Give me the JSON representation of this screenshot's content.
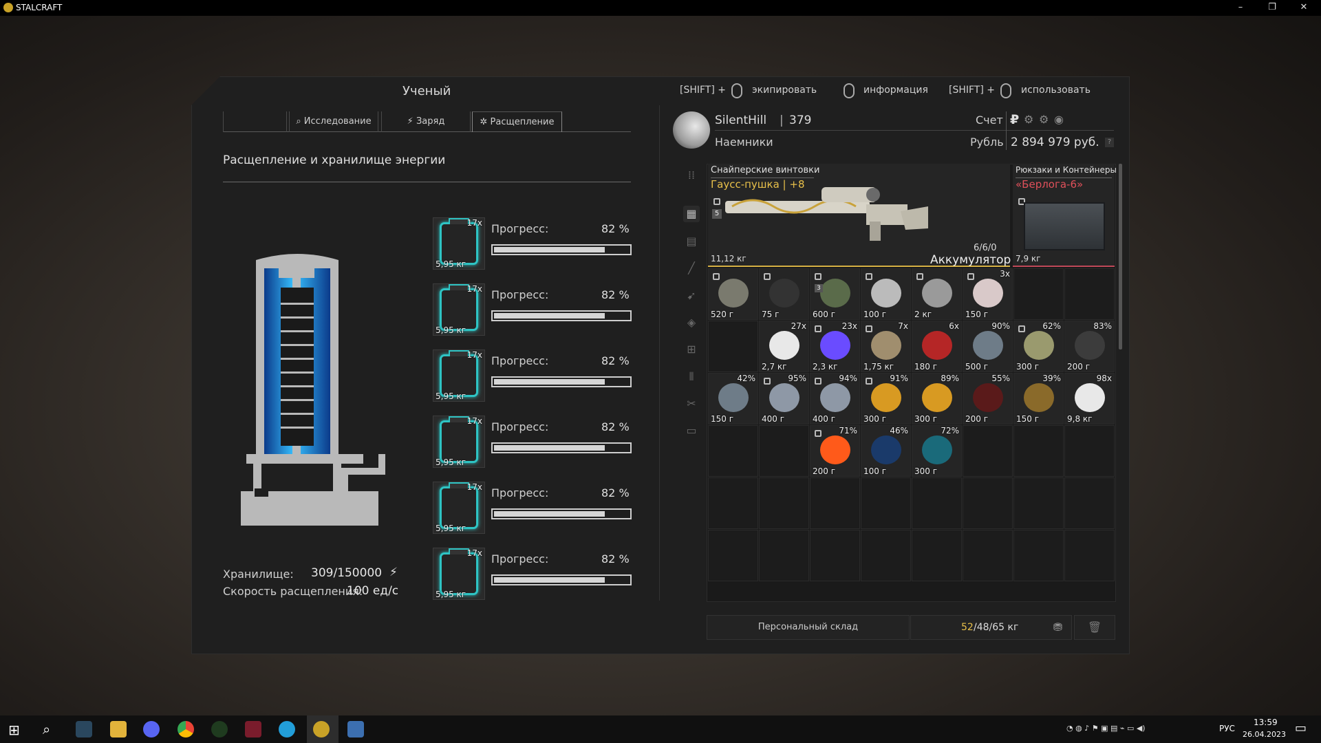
{
  "window": {
    "title": "STALCRAFT"
  },
  "left": {
    "npc_title": "Ученый",
    "tabs": [
      {
        "label": ""
      },
      {
        "label": "Исследование",
        "icon": "magnifier-icon"
      },
      {
        "label": "Заряд",
        "icon": "bolt-icon"
      },
      {
        "label": "Расщепление",
        "icon": "atom-icon"
      }
    ],
    "section_title": "Расщепление и хранилище энергии",
    "slots": [
      {
        "count": "17x",
        "weight": "5,95 кг",
        "progress_label": "Прогресс:",
        "progress": "82 %",
        "fraction": 0.82
      },
      {
        "count": "17x",
        "weight": "5,95 кг",
        "progress_label": "Прогресс:",
        "progress": "82 %",
        "fraction": 0.82
      },
      {
        "count": "17x",
        "weight": "5,95 кг",
        "progress_label": "Прогресс:",
        "progress": "82 %",
        "fraction": 0.82
      },
      {
        "count": "17x",
        "weight": "5,95 кг",
        "progress_label": "Прогресс:",
        "progress": "82 %",
        "fraction": 0.82
      },
      {
        "count": "17x",
        "weight": "5,95 кг",
        "progress_label": "Прогресс:",
        "progress": "82 %",
        "fraction": 0.82
      },
      {
        "count": "17x",
        "weight": "5,95 кг",
        "progress_label": "Прогресс:",
        "progress": "82 %",
        "fraction": 0.82
      }
    ],
    "storage_label": "Хранилище:",
    "storage_value": "309/150000",
    "speed_label": "Скорость расщепления:",
    "speed_value": "100 ед/с"
  },
  "hints": {
    "shift1": "[SHIFT] +",
    "equip": "экипировать",
    "info": "информация",
    "shift2": "[SHIFT] +",
    "use": "использовать"
  },
  "player": {
    "name": "SilentHill",
    "sep": "|",
    "level": "379",
    "faction": "Наемники",
    "account_label": "Счет",
    "currency_label": "Рубль",
    "money": "2 894 979 руб.",
    "currency_symbol": "₽",
    "help": "?"
  },
  "equipped": {
    "weapon_category": "Снайперские винтовки",
    "weapon_name": "Гаусс-пушка | +8",
    "weapon_weight": "11,12 кг",
    "weapon_ammo": "6/6/0",
    "weapon_ammo_type": "Аккумулятор",
    "weapon_badge": "5",
    "backpack_category": "Рюкзаки и Контейнеры",
    "backpack_name": "«Берлога-6»",
    "backpack_weight": "7,9 кг",
    "colors": {
      "weapon_name": "#e8c04a",
      "backpack_name": "#e0505a",
      "accent": "#2ec4c4"
    }
  },
  "inventory": [
    {
      "weight": "520 г",
      "pct": "",
      "lock": true,
      "icon": "scope-icon"
    },
    {
      "weight": "75 г",
      "pct": "",
      "lock": true,
      "icon": "grip-icon"
    },
    {
      "weight": "600 г",
      "pct": "",
      "lock": true,
      "badge": "3",
      "icon": "device-icon"
    },
    {
      "weight": "100 г",
      "pct": "",
      "lock": true,
      "icon": "flashlight-icon"
    },
    {
      "weight": "2 кг",
      "pct": "",
      "lock": true,
      "icon": "plate-icon"
    },
    {
      "weight": "150 г",
      "pct": "3x",
      "lock": true,
      "icon": "pills-icon"
    },
    {
      "weight": "",
      "pct": "",
      "lock": false,
      "icon": ""
    },
    {
      "weight": "",
      "pct": "",
      "lock": false,
      "icon": ""
    },
    {
      "weight": "",
      "pct": "",
      "lock": false,
      "icon": ""
    },
    {
      "weight": "2,7 кг",
      "pct": "27x",
      "lock": false,
      "icon": "snowball-icon"
    },
    {
      "weight": "2,3 кг",
      "pct": "23x",
      "lock": true,
      "icon": "glowstick-icon"
    },
    {
      "weight": "1,75 кг",
      "pct": "7x",
      "lock": true,
      "icon": "bandage-icon"
    },
    {
      "weight": "180 г",
      "pct": "6x",
      "lock": false,
      "icon": "shell-icon"
    },
    {
      "weight": "500 г",
      "pct": "90%",
      "lock": false,
      "icon": "artifact-icon"
    },
    {
      "weight": "300 г",
      "pct": "62%",
      "lock": true,
      "icon": "crystal-icon"
    },
    {
      "weight": "200 г",
      "pct": "83%",
      "lock": false,
      "icon": "shard-icon"
    },
    {
      "weight": "150 г",
      "pct": "42%",
      "lock": false,
      "icon": "artifact-icon"
    },
    {
      "weight": "400 г",
      "pct": "95%",
      "lock": true,
      "icon": "rock-icon"
    },
    {
      "weight": "400 г",
      "pct": "94%",
      "lock": true,
      "icon": "rock-icon"
    },
    {
      "weight": "300 г",
      "pct": "91%",
      "lock": true,
      "icon": "amber-icon"
    },
    {
      "weight": "300 г",
      "pct": "89%",
      "lock": false,
      "icon": "amber-icon"
    },
    {
      "weight": "200 г",
      "pct": "55%",
      "lock": false,
      "icon": "ruby-icon"
    },
    {
      "weight": "150 г",
      "pct": "39%",
      "lock": false,
      "icon": "ring-icon"
    },
    {
      "weight": "9,8 кг",
      "pct": "98x",
      "lock": false,
      "icon": "snowball-icon"
    },
    {
      "weight": "",
      "pct": "",
      "lock": false,
      "icon": ""
    },
    {
      "weight": "",
      "pct": "",
      "lock": false,
      "icon": ""
    },
    {
      "weight": "200 г",
      "pct": "71%",
      "lock": true,
      "icon": "fireball-icon"
    },
    {
      "weight": "100 г",
      "pct": "46%",
      "lock": false,
      "icon": "orb-icon"
    },
    {
      "weight": "300 г",
      "pct": "72%",
      "lock": false,
      "icon": "spark-icon"
    }
  ],
  "footer": {
    "storage_button": "Персональный склад",
    "weight_current": "52",
    "weight_rest": "/48/65 кг"
  },
  "taskbar": {
    "lang": "РУС",
    "time": "13:59",
    "date": "26.04.2023"
  }
}
